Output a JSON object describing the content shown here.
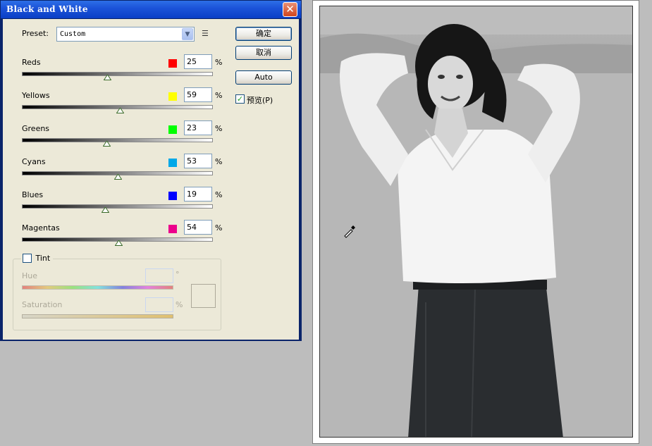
{
  "dialog": {
    "title": "Black and White",
    "preset_label": "Preset:",
    "preset_value": "Custom",
    "ok_label": "确定",
    "cancel_label": "取消",
    "auto_label": "Auto",
    "preview_label": "预览(P)",
    "preview_checked": true,
    "percent_sign": "%",
    "sliders": [
      {
        "label": "Reds",
        "value": "25",
        "color": "#ff0000"
      },
      {
        "label": "Yellows",
        "value": "59",
        "color": "#ffff00"
      },
      {
        "label": "Greens",
        "value": "23",
        "color": "#00ff00"
      },
      {
        "label": "Cyans",
        "value": "53",
        "color": "#00a8e8"
      },
      {
        "label": "Blues",
        "value": "19",
        "color": "#0000ff"
      },
      {
        "label": "Magentas",
        "value": "54",
        "color": "#ec008c"
      }
    ],
    "tint": {
      "label": "Tint",
      "checked": false,
      "hue_label": "Hue",
      "hue_unit": "°",
      "saturation_label": "Saturation",
      "saturation_unit": "%"
    }
  }
}
